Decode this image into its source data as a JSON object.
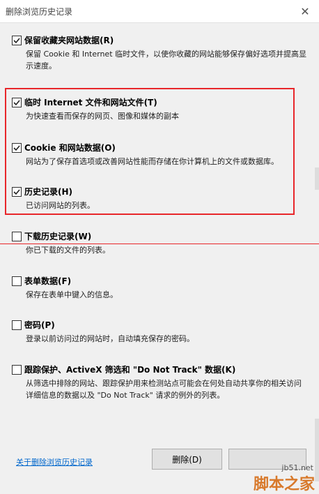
{
  "window": {
    "title": "删除浏览历史记录",
    "close_glyph": "✕"
  },
  "options": [
    {
      "label": "保留收藏夹网站数据(R)",
      "checked": true,
      "description": "保留 Cookie 和 Internet 临时文件，以使你收藏的网站能够保存偏好选项并提高显示速度。"
    },
    {
      "label": "临时 Internet 文件和网站文件(T)",
      "checked": true,
      "description": "为快速查看而保存的网页、图像和媒体的副本"
    },
    {
      "label": "Cookie 和网站数据(O)",
      "checked": true,
      "description": "网站为了保存首选项或改善网站性能而存储在你计算机上的文件或数据库。"
    },
    {
      "label": "历史记录(H)",
      "checked": true,
      "description": "已访问网站的列表。"
    },
    {
      "label": "下载历史记录(W)",
      "checked": false,
      "description": "你已下载的文件的列表。"
    },
    {
      "label": "表单数据(F)",
      "checked": false,
      "description": "保存在表单中键入的信息。"
    },
    {
      "label": "密码(P)",
      "checked": false,
      "description": "登录以前访问过的网站时，自动填充保存的密码。"
    },
    {
      "label": "跟踪保护、ActiveX 筛选和 \"Do Not Track\" 数据(K)",
      "checked": false,
      "description": "从筛选中排除的网站、跟踪保护用来检测站点可能会在何处自动共享你的相关访问详细信息的数据以及 \"Do Not Track\" 请求的例外的列表。"
    }
  ],
  "footer": {
    "about_link": "关于删除浏览历史记录",
    "delete_button": "删除(D)",
    "cancel_button": ""
  },
  "watermark": {
    "site": "jb51.net",
    "brand": "脚本之家"
  },
  "colors": {
    "highlight": "#e8262a",
    "link": "#0066cc",
    "background": "#f0f0f0"
  }
}
